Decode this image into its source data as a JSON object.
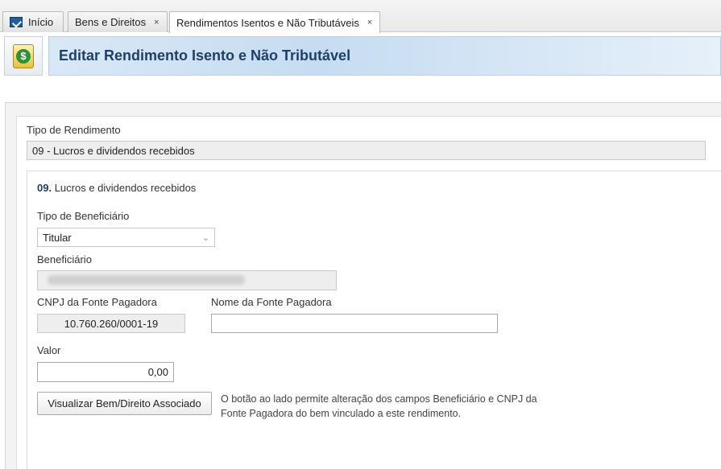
{
  "tabs": [
    {
      "label": "Início",
      "icon": "home-icon",
      "closable": false
    },
    {
      "label": "Bens e Direitos",
      "closable": true
    },
    {
      "label": "Rendimentos Isentos e Não Tributáveis",
      "closable": true,
      "active": true
    }
  ],
  "close_glyph": "×",
  "header": {
    "title": "Editar Rendimento Isento e Não Tributável",
    "icon": "money-document-icon",
    "icon_glyph": "$"
  },
  "form": {
    "tipo_rendimento_label": "Tipo de Rendimento",
    "tipo_rendimento_value": "09 - Lucros e dividendos recebidos",
    "section_code": "09.",
    "section_title": "Lucros e dividendos recebidos",
    "tipo_beneficiario_label": "Tipo de Beneficiário",
    "tipo_beneficiario_value": "Titular",
    "beneficiario_label": "Beneficiário",
    "beneficiario_value": "",
    "cnpj_label": "CNPJ da Fonte Pagadora",
    "cnpj_value": "10.760.260/0001-19",
    "nome_fonte_label": "Nome da Fonte Pagadora",
    "nome_fonte_value": "",
    "valor_label": "Valor",
    "valor_value": "0,00",
    "visualizar_button": "Visualizar Bem/Direito Associado",
    "note": "O botão ao lado permite alteração dos campos Beneficiário e CNPJ da Fonte Pagadora do bem vinculado a este rendimento."
  },
  "colors": {
    "title": "#1f3f66",
    "header_bg": "#c6dcf1",
    "money_green": "#2f8f3a"
  }
}
